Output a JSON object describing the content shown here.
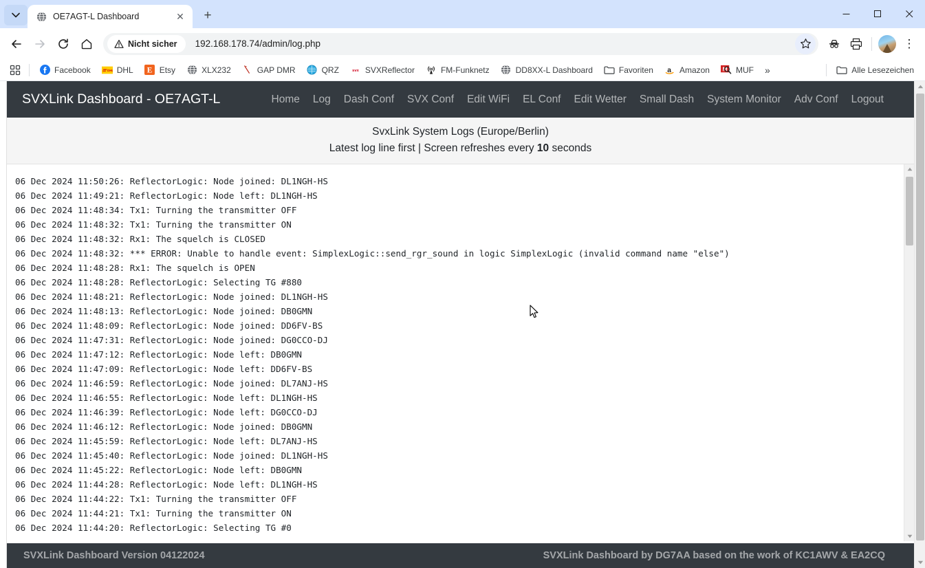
{
  "browser": {
    "tab": {
      "title": "OE7AGT-L Dashboard",
      "favicon": "globe-icon",
      "close_label": "✕"
    },
    "new_tab_label": "+",
    "window_controls": {
      "minimize": "—",
      "maximize": "□",
      "close": "✕"
    },
    "toolbar": {
      "back": "←",
      "forward": "→",
      "reload": "⟳",
      "home": "⌂",
      "security_label": "Nicht sicher",
      "url": "192.168.178.74/admin/log.php",
      "bookmark_star": "☆",
      "incognito": "incognito-icon",
      "print": "print-icon",
      "menu": "⋮"
    },
    "bookmarks": [
      {
        "label": "Facebook",
        "icon": "facebook-icon"
      },
      {
        "label": "DHL",
        "icon": "dhl-icon"
      },
      {
        "label": "Etsy",
        "icon": "etsy-icon"
      },
      {
        "label": "XLX232",
        "icon": "globe-icon"
      },
      {
        "label": "GAP DMR",
        "icon": "antenna-icon"
      },
      {
        "label": "QRZ",
        "icon": "qrz-globe-icon"
      },
      {
        "label": "SVXReflector",
        "icon": "svx-icon"
      },
      {
        "label": "FM-Funknetz",
        "icon": "radio-tower-icon"
      },
      {
        "label": "DD8XX-L Dashboard",
        "icon": "globe-icon"
      },
      {
        "label": "Favoriten",
        "icon": "folder-icon"
      },
      {
        "label": "Amazon",
        "icon": "amazon-icon"
      },
      {
        "label": "MUF",
        "icon": "muf-icon"
      }
    ],
    "bookmarks_overflow": "»",
    "all_bookmarks": {
      "label": "Alle Lesezeichen",
      "icon": "folder-icon"
    }
  },
  "site": {
    "brand": "SVXLink Dashboard - OE7AGT-L",
    "nav": [
      {
        "label": "Home",
        "active": false
      },
      {
        "label": "Log",
        "active": false
      },
      {
        "label": "Dash Conf",
        "active": false
      },
      {
        "label": "SVX Conf",
        "active": false
      },
      {
        "label": "Edit WiFi",
        "active": false
      },
      {
        "label": "EL Conf",
        "active": false
      },
      {
        "label": "Edit Wetter",
        "active": false
      },
      {
        "label": "Small Dash",
        "active": false
      },
      {
        "label": "System Monitor",
        "active": false
      },
      {
        "label": "Adv Conf",
        "active": false
      },
      {
        "label": "Logout",
        "active": false
      }
    ],
    "header": {
      "title": "SvxLink System Logs (Europe/Berlin)",
      "subtitle_pre": "Latest log line first | Screen refreshes every ",
      "refresh_seconds": "10",
      "subtitle_post": " seconds"
    },
    "log_lines": [
      "06 Dec 2024 11:50:26: ReflectorLogic: Node joined: DL1NGH-HS",
      "06 Dec 2024 11:49:21: ReflectorLogic: Node left: DL1NGH-HS",
      "06 Dec 2024 11:48:34: Tx1: Turning the transmitter OFF",
      "06 Dec 2024 11:48:32: Tx1: Turning the transmitter ON",
      "06 Dec 2024 11:48:32: Rx1: The squelch is CLOSED",
      "06 Dec 2024 11:48:32: *** ERROR: Unable to handle event: SimplexLogic::send_rgr_sound in logic SimplexLogic (invalid command name \"else\")",
      "06 Dec 2024 11:48:28: Rx1: The squelch is OPEN",
      "06 Dec 2024 11:48:28: ReflectorLogic: Selecting TG #880",
      "06 Dec 2024 11:48:21: ReflectorLogic: Node joined: DL1NGH-HS",
      "06 Dec 2024 11:48:13: ReflectorLogic: Node joined: DB0GMN",
      "06 Dec 2024 11:48:09: ReflectorLogic: Node joined: DD6FV-BS",
      "06 Dec 2024 11:47:31: ReflectorLogic: Node joined: DG0CCO-DJ",
      "06 Dec 2024 11:47:12: ReflectorLogic: Node left: DB0GMN",
      "06 Dec 2024 11:47:09: ReflectorLogic: Node left: DD6FV-BS",
      "06 Dec 2024 11:46:59: ReflectorLogic: Node joined: DL7ANJ-HS",
      "06 Dec 2024 11:46:55: ReflectorLogic: Node left: DL1NGH-HS",
      "06 Dec 2024 11:46:39: ReflectorLogic: Node left: DG0CCO-DJ",
      "06 Dec 2024 11:46:12: ReflectorLogic: Node joined: DB0GMN",
      "06 Dec 2024 11:45:59: ReflectorLogic: Node left: DL7ANJ-HS",
      "06 Dec 2024 11:45:40: ReflectorLogic: Node joined: DL1NGH-HS",
      "06 Dec 2024 11:45:22: ReflectorLogic: Node left: DB0GMN",
      "06 Dec 2024 11:44:28: ReflectorLogic: Node left: DL1NGH-HS",
      "06 Dec 2024 11:44:22: Tx1: Turning the transmitter OFF",
      "06 Dec 2024 11:44:21: Tx1: Turning the transmitter ON",
      "06 Dec 2024 11:44:20: ReflectorLogic: Selecting TG #0"
    ],
    "footer": {
      "left": "SVXLink Dashboard Version 04122024",
      "right": "SVXLink Dashboard by DG7AA based on the work of KC1AWV & EA2CQ"
    }
  },
  "colors": {
    "navbar_bg": "#343a40",
    "page_bg": "#ffffff",
    "header_panel_bg": "#f5f5f5",
    "tabstrip_bg": "#d3e3fd",
    "text": "#212529"
  }
}
